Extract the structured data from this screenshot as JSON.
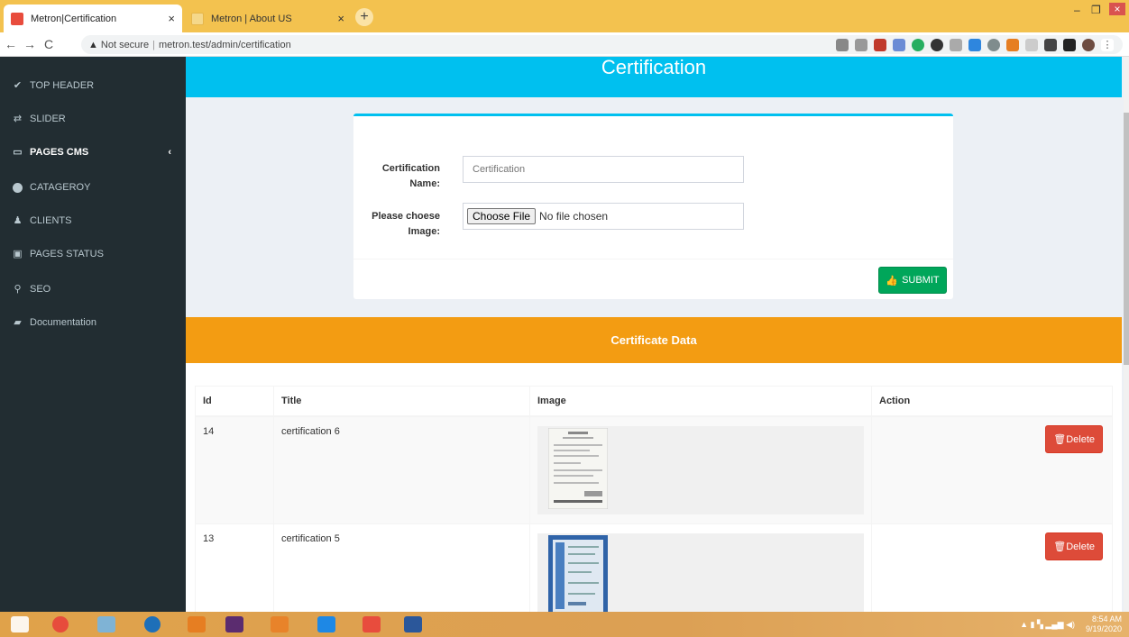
{
  "browser": {
    "tabs": [
      {
        "title": "Metron|Certification",
        "close": "×"
      },
      {
        "title": "Metron | About US",
        "close": "×"
      }
    ],
    "new_tab": "+",
    "window_controls": {
      "minimize": "–",
      "maximize": "❐",
      "close": "×"
    },
    "nav": {
      "back": "←",
      "forward": "→",
      "reload": "C"
    },
    "address": {
      "warning": "▲",
      "security_text": "Not secure",
      "separator": "|",
      "url": "metron.test/admin/certification"
    }
  },
  "sidebar": {
    "items": [
      {
        "label": "TOP HEADER",
        "icon": "check-circle-icon",
        "glyph": "✔"
      },
      {
        "label": "SLIDER",
        "icon": "exchange-icon",
        "glyph": "⇄"
      },
      {
        "label": "PAGES CMS",
        "icon": "laptop-icon",
        "glyph": "▭",
        "chevron": "‹"
      },
      {
        "label": "CATAGEROY",
        "icon": "circle-icon",
        "glyph": ""
      },
      {
        "label": "CLIENTS",
        "icon": "user-icon",
        "glyph": "♟"
      },
      {
        "label": "PAGES STATUS",
        "icon": "image-icon",
        "glyph": "▣"
      },
      {
        "label": "SEO",
        "icon": "search-icon",
        "glyph": "⚲"
      },
      {
        "label": "Documentation",
        "icon": "book-icon",
        "glyph": "▰"
      }
    ]
  },
  "main": {
    "page_title": "Certification",
    "form": {
      "name_label": "Certification Name:",
      "name_placeholder": "Certification",
      "image_label": "Please choese Image:",
      "file_button": "Choose File",
      "file_status": "No file chosen",
      "submit_label": "SUBMIT"
    },
    "section_title": "Certificate Data",
    "table": {
      "headers": [
        "Id",
        "Title",
        "Image",
        "Action"
      ],
      "rows": [
        {
          "id": "14",
          "title": "certification 6",
          "delete_label": "Delete"
        },
        {
          "id": "13",
          "title": "certification 5",
          "delete_label": "Delete"
        }
      ]
    }
  },
  "taskbar": {
    "time": "8:54 AM",
    "date": "9/19/2020"
  },
  "colors": {
    "header_blue": "#00c0ef",
    "sidebar_dark": "#222d32",
    "orange": "#f39c12",
    "submit_green": "#00a65a",
    "delete_red": "#dd4b39"
  }
}
